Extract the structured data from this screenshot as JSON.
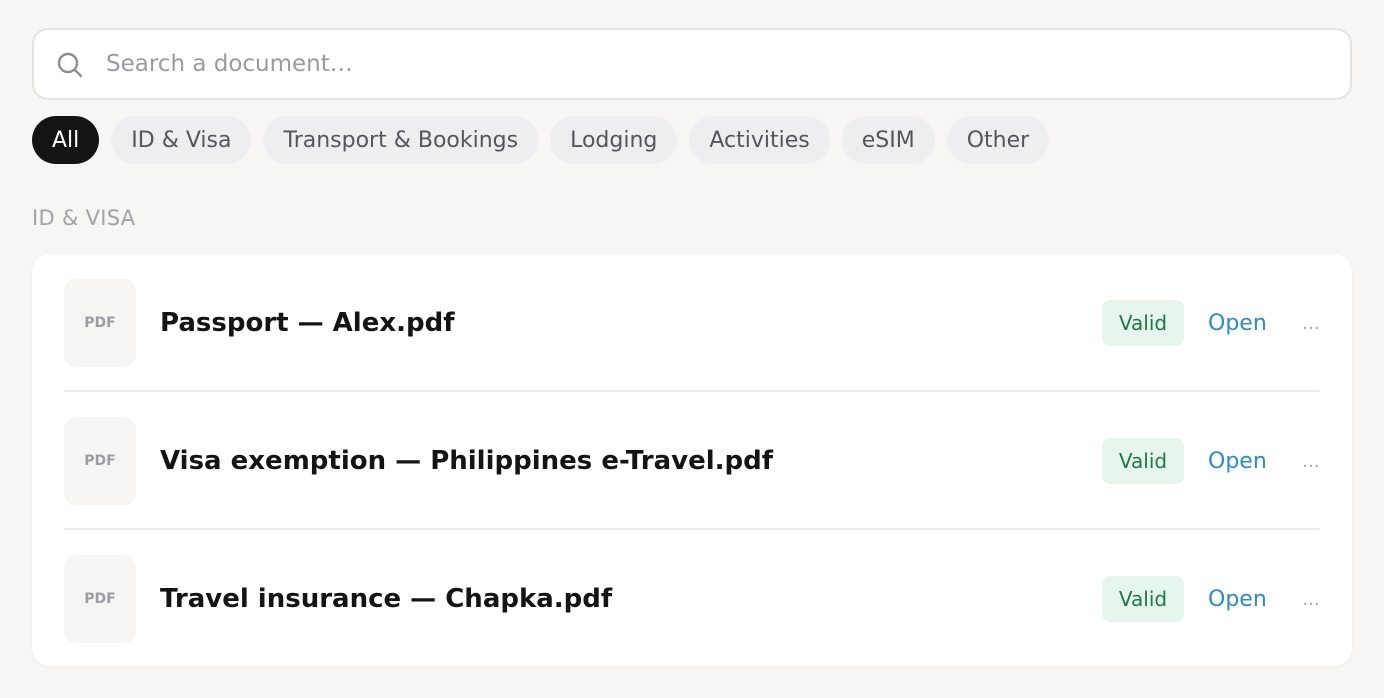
{
  "search": {
    "placeholder": "Search a document…",
    "value": ""
  },
  "filters": [
    {
      "label": "All",
      "active": true
    },
    {
      "label": "ID & Visa",
      "active": false
    },
    {
      "label": "Transport & Bookings",
      "active": false
    },
    {
      "label": "Lodging",
      "active": false
    },
    {
      "label": "Activities",
      "active": false
    },
    {
      "label": "eSIM",
      "active": false
    },
    {
      "label": "Other",
      "active": false
    }
  ],
  "section": {
    "title": "ID & VISA",
    "documents": [
      {
        "type": "PDF",
        "name": "Passport — Alex.pdf",
        "status": "Valid",
        "action": "Open",
        "more": "..."
      },
      {
        "type": "PDF",
        "name": "Visa exemption — Philippines e-Travel.pdf",
        "status": "Valid",
        "action": "Open",
        "more": "..."
      },
      {
        "type": "PDF",
        "name": "Travel insurance — Chapka.pdf",
        "status": "Valid",
        "action": "Open",
        "more": "..."
      }
    ]
  },
  "colors": {
    "background": "#f7f6f4",
    "active_chip": "#141414",
    "chip": "#eeedf0",
    "valid_badge_bg": "#e6f6ec",
    "valid_badge_text": "#1e7a45",
    "link": "#2c8cc4"
  },
  "icons": {
    "search": "search-icon",
    "more": "more-options-icon"
  }
}
